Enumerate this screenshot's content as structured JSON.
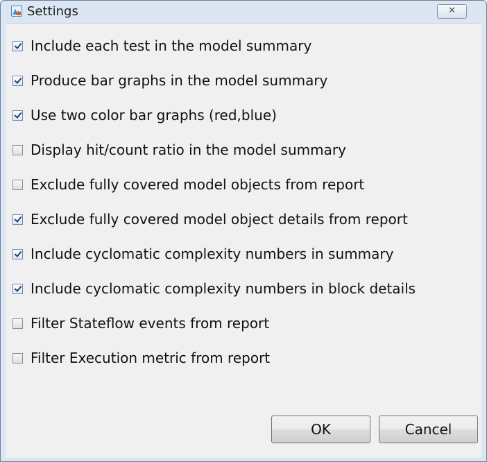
{
  "window": {
    "title": "Settings",
    "close_label": "✕"
  },
  "options": [
    {
      "label": "Include each test in the model summary",
      "checked": true
    },
    {
      "label": "Produce bar graphs in the model summary",
      "checked": true
    },
    {
      "label": "Use two color bar graphs (red,blue)",
      "checked": true
    },
    {
      "label": "Display hit/count ratio in the model summary",
      "checked": false
    },
    {
      "label": "Exclude fully covered model objects from report",
      "checked": false
    },
    {
      "label": "Exclude fully covered model object details from report",
      "checked": true
    },
    {
      "label": "Include cyclomatic complexity numbers in summary",
      "checked": true
    },
    {
      "label": "Include cyclomatic complexity numbers in block details",
      "checked": true
    },
    {
      "label": "Filter Stateflow events from report",
      "checked": false
    },
    {
      "label": "Filter Execution metric from report",
      "checked": false
    }
  ],
  "buttons": {
    "ok": "OK",
    "cancel": "Cancel"
  },
  "icons": {
    "app": "settings-app-icon",
    "close": "close-icon",
    "checkbox": "checkbox-icon"
  }
}
